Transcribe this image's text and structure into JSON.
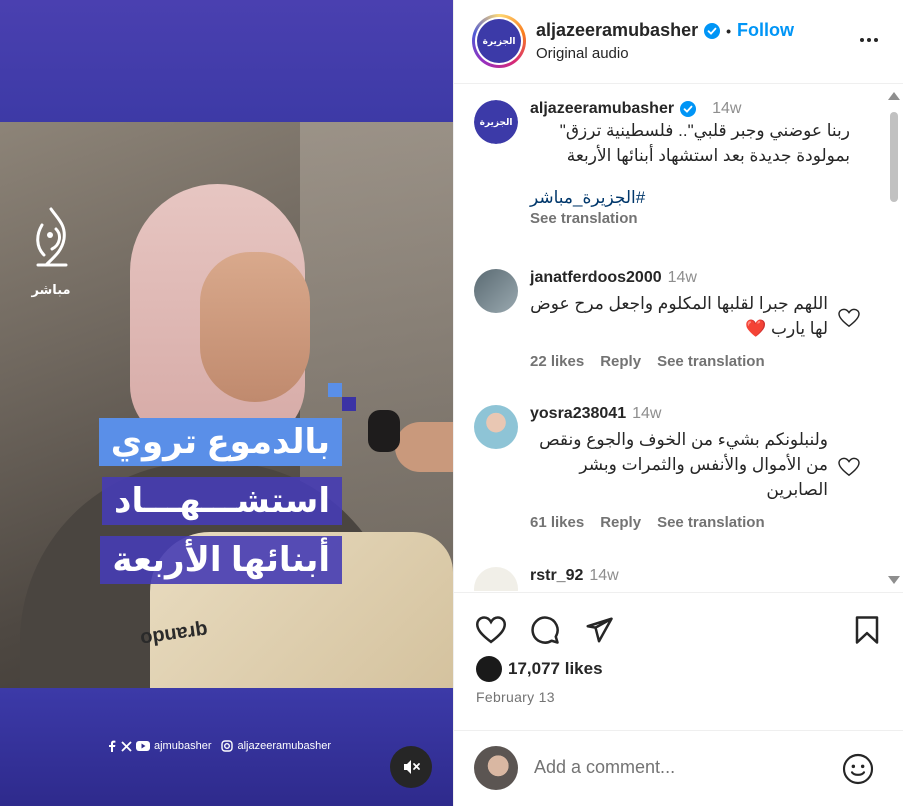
{
  "media": {
    "logo_text": "مباشر",
    "headline": [
      "بالدموع تروي",
      "استشـــهـــاد",
      "أبنائها الأربعة"
    ],
    "socials_handle_1": "ajmubasher",
    "socials_handle_2": "aljazeeramubasher",
    "sweatshirt_text": "opuɐɹb"
  },
  "header": {
    "username": "aljazeeramubasher",
    "separator": "•",
    "follow_label": "Follow",
    "subtitle": "Original audio",
    "avatar_text": "الجزيرة"
  },
  "caption": {
    "username": "aljazeeramubasher",
    "time": "14w",
    "text": "ربنا عوضني وجبر قلبي\".. فلسطينية ترزق\" بمولودة جديدة بعد استشهاد أبنائها الأربعة",
    "hashtag": "#الجزيرة_مباشر",
    "see_translation": "See translation"
  },
  "comments": [
    {
      "username": "janatferdoos2000",
      "time": "14w",
      "text": "اللهم جبرا لقلبها المكلوم واجعل مرح عوض لها يارب ❤️",
      "likes": "22 likes",
      "reply": "Reply",
      "see_translation": "See translation"
    },
    {
      "username": "yosra238041",
      "time": "14w",
      "text": "ولنبلونكم بشيء من الخوف والجوع ونقص من الأموال والأنفس والثمرات وبشر الصابرين",
      "likes": "61 likes",
      "reply": "Reply",
      "see_translation": "See translation"
    },
    {
      "username": "rstr_92",
      "time": "14w"
    }
  ],
  "post": {
    "likes": "17,077 likes",
    "date": "February 13"
  },
  "add_comment": {
    "placeholder": "Add a comment..."
  },
  "colors": {
    "brand_purple": "#3c3aa8",
    "accent_blue": "#5a8fe8",
    "link_blue": "#0095f6",
    "heart_red": "#ff3040"
  }
}
